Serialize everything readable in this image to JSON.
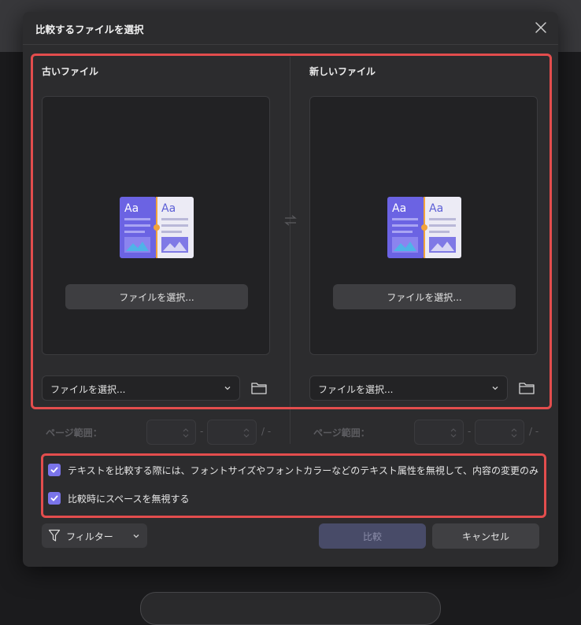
{
  "dialog": {
    "title": "比較するファイルを選択"
  },
  "panels": {
    "old": {
      "title": "古いファイル",
      "pick_button": "ファイルを選択...",
      "select_value": "ファイルを選択...",
      "page_range_label": "ページ範囲："
    },
    "new": {
      "title": "新しいファイル",
      "pick_button": "ファイルを選択...",
      "select_value": "ファイルを選択...",
      "page_range_label": "ページ範囲："
    }
  },
  "icon_text": {
    "aa": "Aa"
  },
  "range_separator": "-",
  "range_suffix": "/ -",
  "options": [
    {
      "label": "テキストを比較する際には、フォントサイズやフォントカラーなどのテキスト属性を無視して、内容の変更のみ",
      "checked": true
    },
    {
      "label": "比較時にスペースを無視する",
      "checked": true
    }
  ],
  "footer": {
    "filter_label": "フィルター",
    "compare_label": "比較",
    "cancel_label": "キャンセル"
  },
  "colors": {
    "accent": "#7a74ea",
    "highlight": "#e34d4d"
  }
}
